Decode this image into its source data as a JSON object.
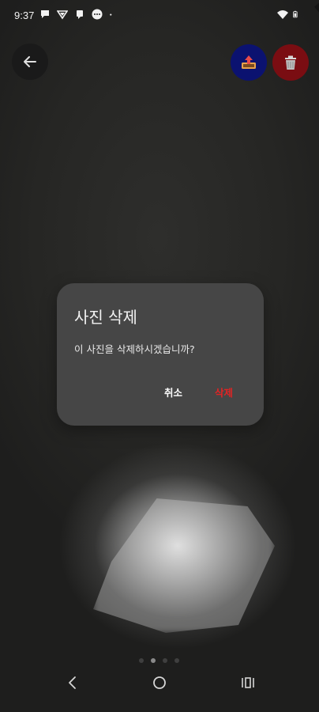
{
  "status_bar": {
    "time": "9:37",
    "left_icons": [
      "chat-bubble-icon",
      "nfc-icon",
      "message-icon",
      "ellipsis-circle-icon",
      "dot-icon"
    ],
    "right_icons": [
      "wifi-icon",
      "battery-icon"
    ]
  },
  "toolbar": {
    "back_icon": "arrow-left-icon",
    "share_icon": "share-tray-icon",
    "delete_icon": "trash-icon",
    "share_color": "#0b1270",
    "delete_color": "#7a0d12"
  },
  "dialog": {
    "title": "사진 삭제",
    "message": "이 사진을 삭제하시겠습니까?",
    "cancel_label": "취소",
    "delete_label": "삭제",
    "delete_color": "#e02424"
  },
  "pager": {
    "count": 4,
    "active_index": 1
  },
  "nav_bar": {
    "icons": [
      "nav-back-icon",
      "nav-home-icon",
      "nav-recents-icon"
    ]
  }
}
